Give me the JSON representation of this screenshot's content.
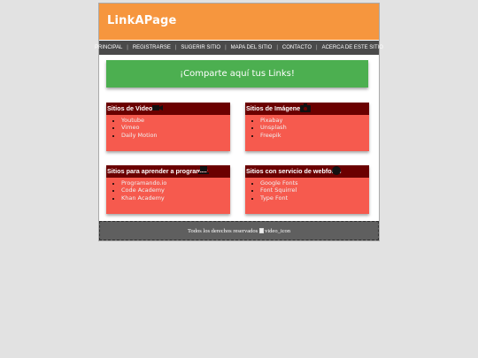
{
  "brand": {
    "logo_text": "LinkAPage"
  },
  "nav": {
    "items": [
      "PRINCIPAL",
      "REGISTRARSE",
      "SUGERIR SITIO",
      "MAPA DEL SITIO",
      "CONTACTO",
      "ACERCA DE ESTE SITIO"
    ]
  },
  "share_button": {
    "label": "¡Comparte aquí tus Links!"
  },
  "cards": [
    {
      "title": "Sitios de Videos",
      "icon": "video-camera-icon",
      "links": [
        "Youtube",
        "Vimeo",
        "Daily Motion"
      ]
    },
    {
      "title": "Sitios de Imágenes",
      "icon": "camera-icon",
      "links": [
        "Pixabay",
        "Unsplash",
        "Freepik"
      ]
    },
    {
      "title": "Sitios para aprender a programar",
      "icon": "laptop-icon",
      "links": [
        "Programando.io",
        "Code Academy",
        "Khan Academy"
      ]
    },
    {
      "title": "Sitios con servicio de webfonts",
      "icon": "font-circle-icon",
      "links": [
        "Google Fonts",
        "Font Squirrel",
        "Type Font"
      ]
    }
  ],
  "footer": {
    "text": "Todos los derechos reservados",
    "image_alt": "video_icon"
  },
  "colors": {
    "header": "#f6963e",
    "nav": "#4a4a4a",
    "share": "#4caf50",
    "card": "#f65a4e",
    "card_title": "#6b0000",
    "footer": "#5f5f5f",
    "background": "#e2e2e2"
  }
}
